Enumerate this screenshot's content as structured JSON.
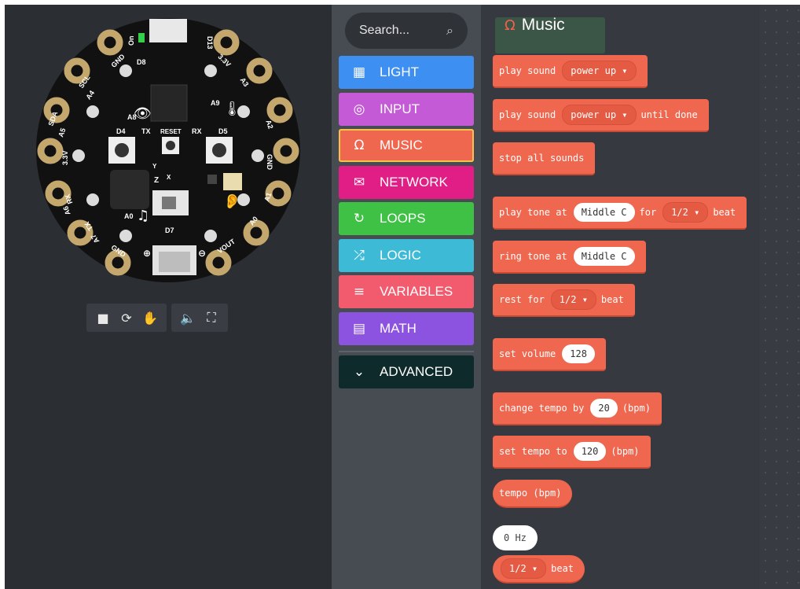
{
  "simulator": {
    "board_labels": {
      "on": "On",
      "d13": "D13",
      "gnd_top": "GND",
      "d8": "D8",
      "scl": "SCL",
      "a4": "A4",
      "v33_top": "3.3V",
      "a3": "A3",
      "a8": "A8",
      "a9": "A9",
      "sda": "SDA",
      "a5": "A5",
      "a2": "A2",
      "d4": "D4",
      "tx_top": "TX",
      "reset": "RESET",
      "rx_top": "RX",
      "d5": "D5",
      "v33_left": "3.3V",
      "gnd_right": "GND",
      "btn_a": "A",
      "btn_b": "B",
      "rx_left": "RX",
      "a6": "A6",
      "a1": "A1",
      "a0_mid": "A0",
      "d7": "D7",
      "tx_left": "TX",
      "a7": "A7",
      "a0_right": "A0",
      "gnd_bottom": "GND",
      "vout": "VOUT",
      "z_axis": "Z",
      "y_axis": "Y",
      "x_axis": "X"
    },
    "toolbar": {
      "stop_icon": "stop-icon",
      "restart_icon": "restart-icon",
      "debug_icon": "debug-icon",
      "mute_icon": "volume-icon",
      "fullscreen_icon": "fullscreen-icon",
      "stop": "■",
      "restart": "⟳",
      "debug": "✋",
      "mute": "🔈",
      "fullscreen": "⛶"
    }
  },
  "toolbox": {
    "search_placeholder": "Search...",
    "categories": [
      {
        "label": "LIGHT",
        "icon": "grid-icon",
        "glyph": "▦",
        "color": "#3d8ff2"
      },
      {
        "label": "INPUT",
        "icon": "target-icon",
        "glyph": "◎",
        "color": "#c45ad6"
      },
      {
        "label": "MUSIC",
        "icon": "headphones-icon",
        "glyph": "Ω",
        "color": "#f0674f"
      },
      {
        "label": "NETWORK",
        "icon": "chat-icon",
        "glyph": "✉",
        "color": "#e01e86"
      },
      {
        "label": "LOOPS",
        "icon": "loop-icon",
        "glyph": "↻",
        "color": "#3fc145"
      },
      {
        "label": "LOGIC",
        "icon": "shuffle-icon",
        "glyph": "⤮",
        "color": "#3dbad6"
      },
      {
        "label": "VARIABLES",
        "icon": "list-icon",
        "glyph": "≡",
        "color": "#f25b6e"
      },
      {
        "label": "MATH",
        "icon": "calculator-icon",
        "glyph": "▤",
        "color": "#8c53e0"
      }
    ],
    "advanced": {
      "label": "ADVANCED",
      "icon": "chevron-down-icon",
      "glyph": "⌄",
      "color": "#0f2a2a"
    },
    "selected": "MUSIC"
  },
  "flyout": {
    "title": "Music",
    "title_icon": "headphones-icon",
    "colors": {
      "block": "#f0674f",
      "block_dark": "#c94a35"
    },
    "blocks": {
      "play_sound": {
        "prefix": "play sound",
        "option": "power up ▾"
      },
      "play_sound_done": {
        "prefix": "play sound",
        "option": "power up ▾",
        "suffix": "until done"
      },
      "stop_sounds": {
        "label": "stop all sounds"
      },
      "play_tone": {
        "prefix": "play tone at",
        "note": "Middle C",
        "mid": "for",
        "beat": "1/2 ▾",
        "suffix": "beat"
      },
      "ring_tone": {
        "prefix": "ring tone at",
        "note": "Middle C"
      },
      "rest": {
        "prefix": "rest for",
        "beat": "1/2 ▾",
        "suffix": "beat"
      },
      "set_volume": {
        "prefix": "set volume",
        "value": "128"
      },
      "change_tempo": {
        "prefix": "change tempo by",
        "value": "20",
        "suffix": "(bpm)"
      },
      "set_tempo": {
        "prefix": "set tempo to",
        "value": "120",
        "suffix": "(bpm)"
      },
      "tempo": {
        "label": "tempo (bpm)"
      },
      "hz": {
        "label": "0 Hz"
      },
      "beat": {
        "option": "1/2 ▾",
        "suffix": "beat"
      }
    }
  }
}
